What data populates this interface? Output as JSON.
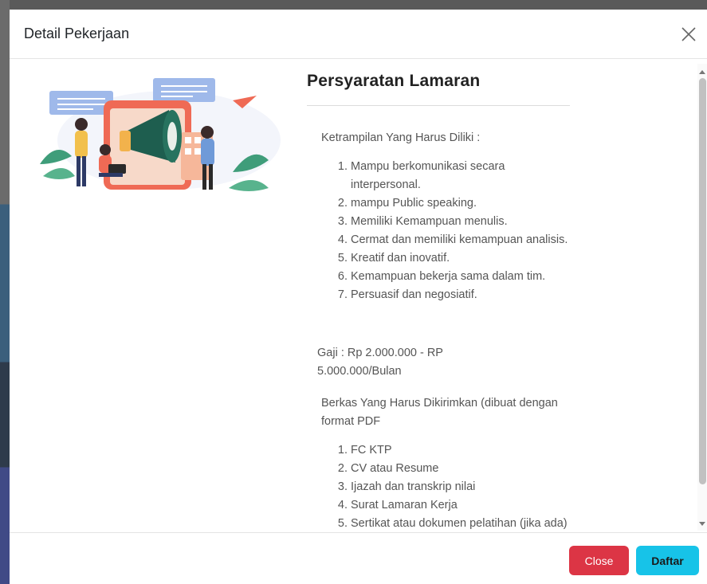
{
  "modal": {
    "title": "Detail Pekerjaan",
    "close_icon": "close-icon"
  },
  "illustration": {
    "icon": "megaphone-illustration"
  },
  "content": {
    "heading": "Persyaratan Lamaran",
    "skills_intro": "Ketrampilan Yang Harus Diliki :",
    "skills": [
      "Mampu berkomunikasi secara interpersonal.",
      "mampu Public speaking.",
      "Memiliki Kemampuan menulis.",
      "Cermat dan memiliki kemampuan analisis.",
      "Kreatif dan inovatif.",
      "Kemampuan bekerja sama dalam tim.",
      "Persuasif dan negosiatif."
    ],
    "salary": "Gaji : Rp 2.000.000 - RP 5.000.000/Bulan",
    "documents_intro": "Berkas Yang Harus Dikirimkan (dibuat dengan format PDF",
    "documents": [
      "FC KTP",
      "CV atau Resume",
      "Ijazah dan transkrip nilai",
      "Surat Lamaran Kerja",
      "Sertikat atau dokumen pelatihan (jika ada)"
    ]
  },
  "footer": {
    "close_label": "Close",
    "daftar_label": "Daftar"
  },
  "colors": {
    "close_button": "#dc3545",
    "daftar_button": "#17c3e8"
  }
}
